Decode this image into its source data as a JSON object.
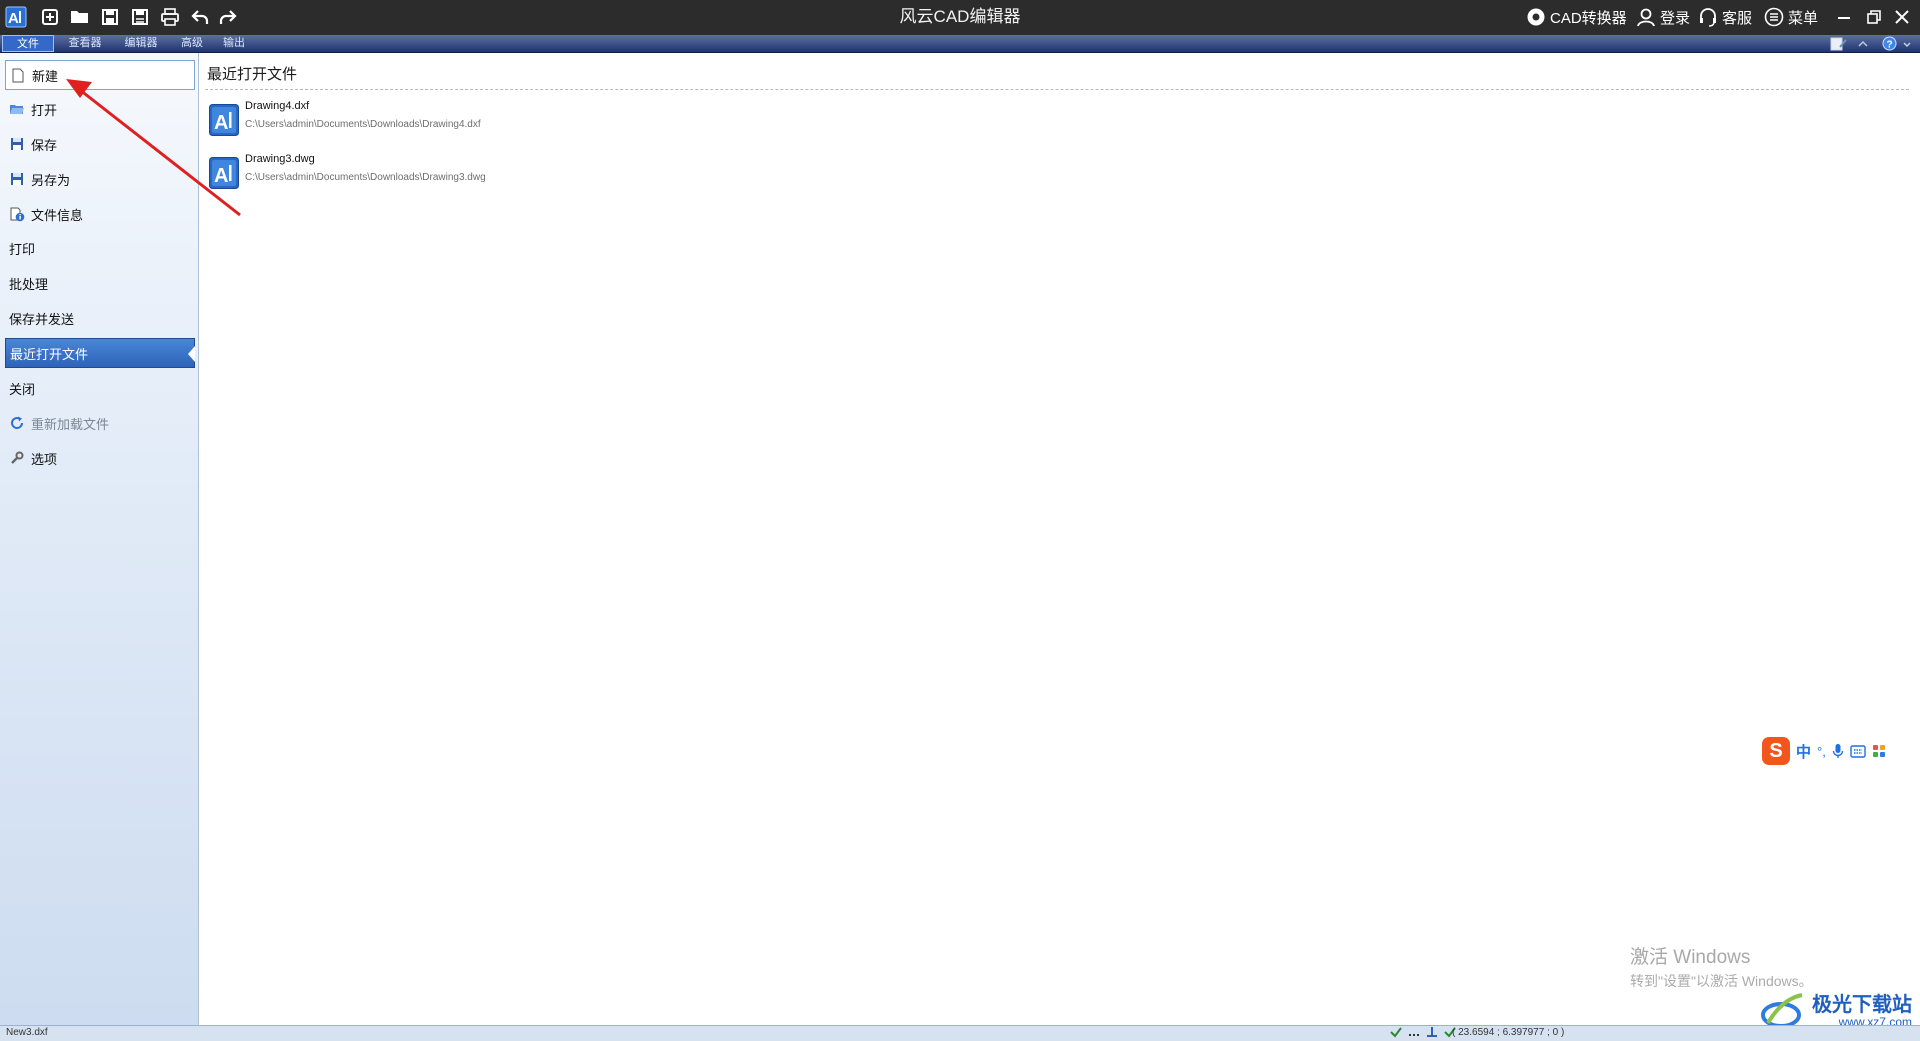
{
  "app": {
    "title": "风云CAD编辑器"
  },
  "quick_access": [
    {
      "name": "app-logo-icon"
    },
    {
      "name": "new-file-icon"
    },
    {
      "name": "open-folder-icon"
    },
    {
      "name": "save-icon"
    },
    {
      "name": "save-as-icon"
    },
    {
      "name": "print-icon"
    },
    {
      "name": "undo-icon"
    },
    {
      "name": "redo-icon"
    }
  ],
  "titlebar_right": {
    "converter_label": "CAD转换器",
    "login_label": "登录",
    "support_label": "客服",
    "menu_label": "菜单"
  },
  "ribbon": {
    "tabs": [
      {
        "label": "文件",
        "active": true
      },
      {
        "label": "查看器",
        "active": false
      },
      {
        "label": "编辑器",
        "active": false
      },
      {
        "label": "高级",
        "active": false
      },
      {
        "label": "输出",
        "active": false
      }
    ]
  },
  "sidebar": {
    "items": [
      {
        "label": "新建",
        "icon": "new-doc-icon",
        "state": "selected"
      },
      {
        "label": "打开",
        "icon": "open-icon",
        "state": "normal"
      },
      {
        "label": "保存",
        "icon": "save-icon",
        "state": "normal"
      },
      {
        "label": "另存为",
        "icon": "save-as-icon",
        "state": "normal"
      },
      {
        "label": "文件信息",
        "icon": "file-info-icon",
        "state": "normal"
      },
      {
        "label": "打印",
        "icon": "",
        "state": "normal"
      },
      {
        "label": "批处理",
        "icon": "",
        "state": "normal"
      },
      {
        "label": "保存并发送",
        "icon": "",
        "state": "normal"
      },
      {
        "label": "最近打开文件",
        "icon": "",
        "state": "active"
      },
      {
        "label": "关闭",
        "icon": "",
        "state": "normal"
      },
      {
        "label": "重新加载文件",
        "icon": "reload-icon",
        "state": "disabled"
      },
      {
        "label": "选项",
        "icon": "wrench-icon",
        "state": "normal"
      }
    ]
  },
  "recent": {
    "title": "最近打开文件",
    "files": [
      {
        "name": "Drawing4.dxf",
        "path": "C:\\Users\\admin\\Documents\\Downloads\\Drawing4.dxf"
      },
      {
        "name": "Drawing3.dwg",
        "path": "C:\\Users\\admin\\Documents\\Downloads\\Drawing3.dwg"
      }
    ]
  },
  "ime": {
    "logo": "S",
    "mode": "中",
    "punct": "°,"
  },
  "status": {
    "file": "New3.dxf",
    "coords": "( 23.6594 ; 6.397977 ; 0 )"
  },
  "watermark": {
    "title": "激活 Windows",
    "subtitle": "转到\"设置\"以激活 Windows。",
    "site_name": "极光下载站",
    "site_url": "www.xz7.com"
  },
  "colors": {
    "titlebar": "#2c2c2c",
    "ribbon": "#1f3570",
    "active_item": "#2e63b8",
    "annotation_arrow": "#e02020"
  }
}
